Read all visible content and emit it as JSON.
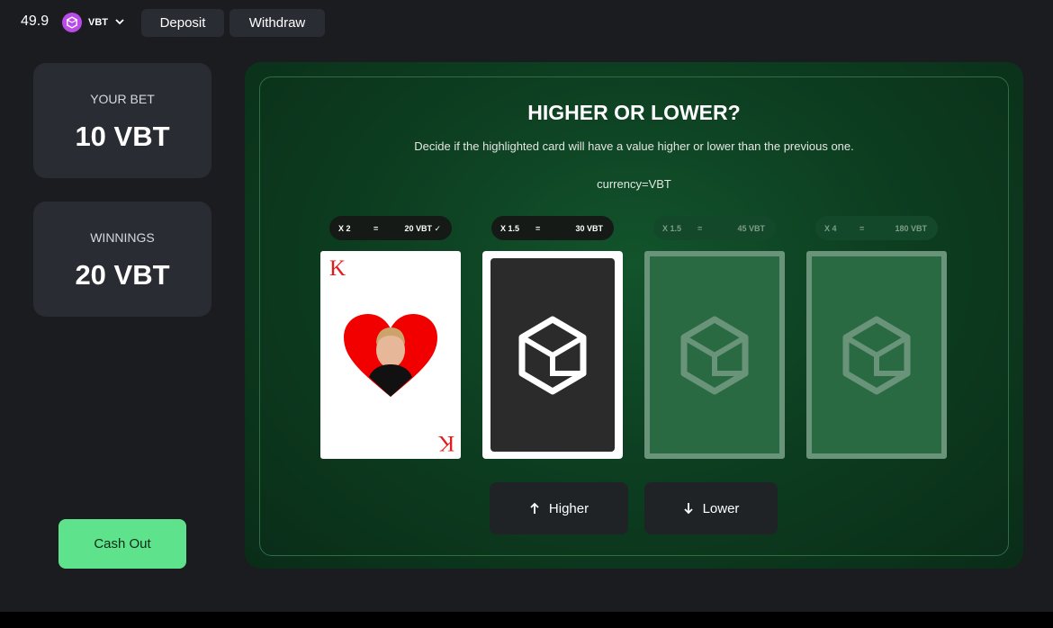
{
  "topbar": {
    "balance": "49.9",
    "currency": "VBT",
    "deposit_label": "Deposit",
    "withdraw_label": "Withdraw"
  },
  "stats": {
    "bet_label": "YOUR BET",
    "bet_value": "10 VBT",
    "winnings_label": "WINNINGS",
    "winnings_value": "20 VBT"
  },
  "cashout_label": "Cash Out",
  "game": {
    "title": "HIGHER OR LOWER?",
    "subtitle": "Decide if the highlighted card will have a value higher or lower than the previous one.",
    "currency_text": "currency=VBT",
    "multipliers": [
      {
        "x": "X 2",
        "eq": "=",
        "value": "20 VBT ✓"
      },
      {
        "x": "X 1.5",
        "eq": "=",
        "value": "30 VBT"
      },
      {
        "x": "X 1.5",
        "eq": "=",
        "value": "45 VBT"
      },
      {
        "x": "X 4",
        "eq": "=",
        "value": "180 VBT"
      }
    ],
    "first_card": {
      "rank": "K",
      "suit": "hearts"
    },
    "higher_label": "Higher",
    "lower_label": "Lower"
  },
  "colors": {
    "accent_green": "#5ee38c",
    "card_red": "#e21c1c",
    "coin_purple": "#b94be8"
  }
}
